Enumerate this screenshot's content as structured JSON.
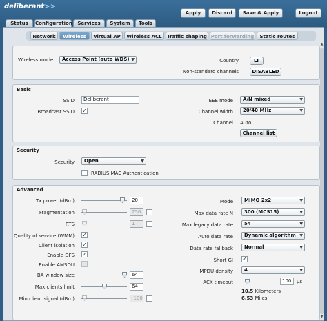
{
  "header": {
    "logo_text": "deliberant",
    "logo_mark": ">>",
    "buttons": [
      "Apply",
      "Discard",
      "Save & Apply",
      "Logout"
    ]
  },
  "main_tabs": [
    "Status",
    "Configuration",
    "Services",
    "System",
    "Tools"
  ],
  "active_main_tab": "Configuration",
  "sub_tabs": [
    "Network",
    "Wireless",
    "Virtual AP",
    "Wireless ACL",
    "Traffic shaping",
    "Port forwarding",
    "Static routes"
  ],
  "active_sub_tab": "Wireless",
  "general": {
    "wireless_mode_label": "Wireless mode",
    "wireless_mode_value": "Access Point (auto WDS)",
    "country_label": "Country",
    "country_value": "LT",
    "nonstandard_label": "Non-standard channels",
    "nonstandard_value": "DISABLED"
  },
  "basic": {
    "title": "Basic",
    "ssid_label": "SSID",
    "ssid_value": "Deliberant",
    "broadcast_label": "Broadcast SSID",
    "broadcast_checked": "✓",
    "ieee_label": "IEEE mode",
    "ieee_value": "A/N mixed",
    "width_label": "Channel width",
    "width_value": "20/40 MHz",
    "channel_label": "Channel",
    "channel_value": "Auto",
    "channel_list_button": "Channel list"
  },
  "security": {
    "title": "Security",
    "security_label": "Security",
    "security_value": "Open",
    "radius_label": "RADIUS MAC Authentication"
  },
  "advanced": {
    "title": "Advanced",
    "tx_power_label": "Tx power (dBm)",
    "tx_power_value": "20",
    "fragmentation_label": "Fragmentation",
    "fragmentation_value": "256",
    "rts_label": "RTS",
    "rts_value": "1",
    "qos_label": "Quality of service (WMM)",
    "isolation_label": "Client isolation",
    "dfs_label": "Enable DFS",
    "amsdu_label": "Enable AMSDU",
    "ba_label": "BA window size",
    "ba_value": "64",
    "max_clients_label": "Max clients limit",
    "max_clients_value": "64",
    "min_signal_label": "Min client signal (dBm)",
    "min_signal_value": "-100",
    "check_mark": "✓",
    "mode_label": "Mode",
    "mode_value": "MIMO 2x2",
    "max_rate_n_label": "Max data rate N",
    "max_rate_n_value": "300 (MCS15)",
    "max_legacy_label": "Max legacy data rate",
    "max_legacy_value": "54",
    "auto_rate_label": "Auto data rate",
    "auto_rate_value": "Dynamic algorithm",
    "fallback_label": "Data rate fallback",
    "fallback_value": "Normal",
    "short_gi_label": "Short GI",
    "mpdu_label": "MPDU density",
    "mpdu_value": "4",
    "ack_label": "ACK timeout",
    "ack_value": "100",
    "ack_unit": "µs",
    "distance_km_value": "10.5",
    "distance_km_unit": "Kilometers",
    "distance_mi_value": "6.53",
    "distance_mi_unit": "Miles"
  },
  "slider_levels": {
    "tx_power": 0.95,
    "fragmentation": 0.02,
    "rts": 0.02,
    "ba_window": 1.0,
    "max_clients": 0.5,
    "min_signal": 0.02,
    "ack_timeout": 0.1
  }
}
